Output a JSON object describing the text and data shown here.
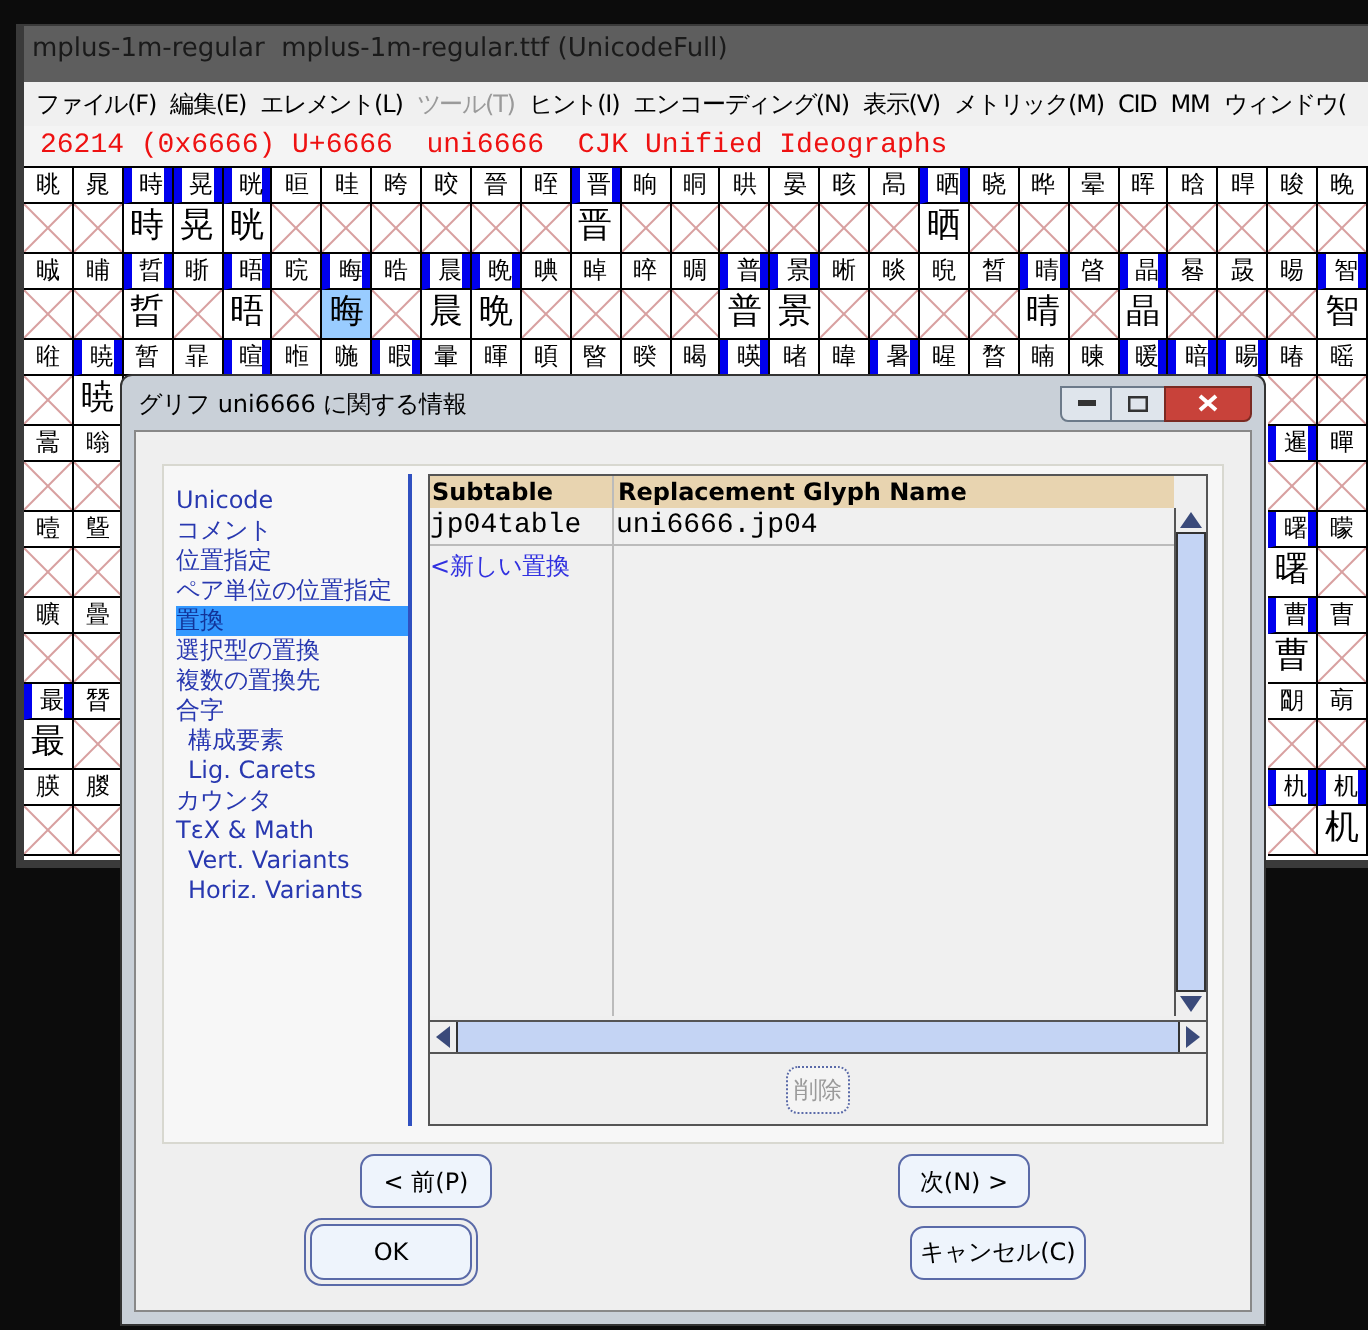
{
  "main_window": {
    "title": "mplus-1m-regular  mplus-1m-regular.ttf (UnicodeFull)",
    "menu": [
      {
        "label": "ファイル(F)",
        "disabled": false
      },
      {
        "label": "編集(E)",
        "disabled": false
      },
      {
        "label": "エレメント(L)",
        "disabled": false
      },
      {
        "label": "ツール(T)",
        "disabled": true
      },
      {
        "label": "ヒント(I)",
        "disabled": false
      },
      {
        "label": "エンコーディング(N)",
        "disabled": false
      },
      {
        "label": "表示(V)",
        "disabled": false
      },
      {
        "label": "メトリック(M)",
        "disabled": false
      },
      {
        "label": "CID",
        "disabled": false
      },
      {
        "label": "MM",
        "disabled": false
      },
      {
        "label": "ウィンドウ(",
        "disabled": false
      }
    ],
    "info_line": "26214 (0x6666) U+6666  uni6666  CJK Unified Ideographs",
    "grid": {
      "rows": [
        {
          "cells": [
            {
              "label": "晀",
              "flagged": false,
              "kind": "empty",
              "selected": false
            },
            {
              "label": "晁",
              "flagged": false,
              "kind": "empty",
              "selected": false
            },
            {
              "label": "時",
              "flagged": true,
              "kind": "glyph",
              "glyph": "時",
              "selected": false
            },
            {
              "label": "晃",
              "flagged": true,
              "kind": "glyph",
              "glyph": "晃",
              "selected": false
            },
            {
              "label": "晄",
              "flagged": true,
              "kind": "glyph",
              "glyph": "晄",
              "selected": false
            },
            {
              "label": "晅",
              "flagged": false,
              "kind": "empty",
              "selected": false
            },
            {
              "label": "晆",
              "flagged": false,
              "kind": "empty",
              "selected": false
            },
            {
              "label": "晇",
              "flagged": false,
              "kind": "empty",
              "selected": false
            },
            {
              "label": "晈",
              "flagged": false,
              "kind": "empty",
              "selected": false
            },
            {
              "label": "晉",
              "flagged": false,
              "kind": "empty",
              "selected": false
            },
            {
              "label": "晊",
              "flagged": false,
              "kind": "empty",
              "selected": false
            },
            {
              "label": "晋",
              "flagged": true,
              "kind": "glyph",
              "glyph": "晋",
              "selected": false
            },
            {
              "label": "晌",
              "flagged": false,
              "kind": "empty",
              "selected": false
            },
            {
              "label": "晍",
              "flagged": false,
              "kind": "empty",
              "selected": false
            },
            {
              "label": "晎",
              "flagged": false,
              "kind": "empty",
              "selected": false
            },
            {
              "label": "晏",
              "flagged": false,
              "kind": "empty",
              "selected": false
            },
            {
              "label": "晐",
              "flagged": false,
              "kind": "empty",
              "selected": false
            },
            {
              "label": "晑",
              "flagged": false,
              "kind": "empty",
              "selected": false
            },
            {
              "label": "晒",
              "flagged": true,
              "kind": "glyph",
              "glyph": "晒",
              "selected": false
            },
            {
              "label": "晓",
              "flagged": false,
              "kind": "empty",
              "selected": false
            },
            {
              "label": "晔",
              "flagged": false,
              "kind": "empty",
              "selected": false
            },
            {
              "label": "晕",
              "flagged": false,
              "kind": "empty",
              "selected": false
            },
            {
              "label": "晖",
              "flagged": false,
              "kind": "empty",
              "selected": false
            },
            {
              "label": "晗",
              "flagged": false,
              "kind": "empty",
              "selected": false
            },
            {
              "label": "晘",
              "flagged": false,
              "kind": "empty",
              "selected": false
            },
            {
              "label": "晙",
              "flagged": false,
              "kind": "empty",
              "selected": false
            },
            {
              "label": "晚",
              "flagged": false,
              "kind": "empty",
              "selected": false
            }
          ]
        },
        {
          "cells": [
            {
              "label": "晠",
              "flagged": false,
              "kind": "empty",
              "selected": false
            },
            {
              "label": "晡",
              "flagged": false,
              "kind": "empty",
              "selected": false
            },
            {
              "label": "晢",
              "flagged": true,
              "kind": "glyph",
              "glyph": "晢",
              "selected": false
            },
            {
              "label": "晣",
              "flagged": false,
              "kind": "empty",
              "selected": false
            },
            {
              "label": "晤",
              "flagged": true,
              "kind": "glyph",
              "glyph": "晤",
              "selected": false
            },
            {
              "label": "晥",
              "flagged": false,
              "kind": "empty",
              "selected": false
            },
            {
              "label": "晦",
              "flagged": true,
              "kind": "glyph",
              "glyph": "晦",
              "selected": true
            },
            {
              "label": "晧",
              "flagged": false,
              "kind": "empty",
              "selected": false
            },
            {
              "label": "晨",
              "flagged": true,
              "kind": "glyph",
              "glyph": "晨",
              "selected": false
            },
            {
              "label": "晩",
              "flagged": true,
              "kind": "glyph",
              "glyph": "晩",
              "selected": false
            },
            {
              "label": "晪",
              "flagged": false,
              "kind": "empty",
              "selected": false
            },
            {
              "label": "晫",
              "flagged": false,
              "kind": "empty",
              "selected": false
            },
            {
              "label": "晬",
              "flagged": false,
              "kind": "empty",
              "selected": false
            },
            {
              "label": "晭",
              "flagged": false,
              "kind": "empty",
              "selected": false
            },
            {
              "label": "普",
              "flagged": true,
              "kind": "glyph",
              "glyph": "普",
              "selected": false
            },
            {
              "label": "景",
              "flagged": true,
              "kind": "glyph",
              "glyph": "景",
              "selected": false
            },
            {
              "label": "晰",
              "flagged": false,
              "kind": "empty",
              "selected": false
            },
            {
              "label": "晱",
              "flagged": false,
              "kind": "empty",
              "selected": false
            },
            {
              "label": "晲",
              "flagged": false,
              "kind": "empty",
              "selected": false
            },
            {
              "label": "晳",
              "flagged": false,
              "kind": "empty",
              "selected": false
            },
            {
              "label": "晴",
              "flagged": true,
              "kind": "glyph",
              "glyph": "晴",
              "selected": false
            },
            {
              "label": "晵",
              "flagged": false,
              "kind": "empty",
              "selected": false
            },
            {
              "label": "晶",
              "flagged": true,
              "kind": "glyph",
              "glyph": "晶",
              "selected": false
            },
            {
              "label": "晷",
              "flagged": false,
              "kind": "empty",
              "selected": false
            },
            {
              "label": "晸",
              "flagged": false,
              "kind": "empty",
              "selected": false
            },
            {
              "label": "晹",
              "flagged": false,
              "kind": "empty",
              "selected": false
            },
            {
              "label": "智",
              "flagged": true,
              "kind": "glyph",
              "glyph": "智",
              "selected": false
            }
          ]
        },
        {
          "cells": [
            {
              "label": "暀",
              "flagged": false,
              "kind": "empty",
              "selected": false
            },
            {
              "label": "暁",
              "flagged": true,
              "kind": "glyph",
              "glyph": "暁",
              "selected": false
            },
            {
              "label": "暂",
              "flagged": false,
              "kind": "hidden",
              "selected": false
            },
            {
              "label": "暃",
              "flagged": false,
              "kind": "hidden",
              "selected": false
            },
            {
              "label": "暄",
              "flagged": true,
              "kind": "hidden",
              "selected": false
            },
            {
              "label": "暅",
              "flagged": false,
              "kind": "hidden",
              "selected": false
            },
            {
              "label": "暆",
              "flagged": false,
              "kind": "hidden",
              "selected": false
            },
            {
              "label": "暇",
              "flagged": true,
              "kind": "hidden",
              "selected": false
            },
            {
              "label": "暈",
              "flagged": false,
              "kind": "hidden",
              "selected": false
            },
            {
              "label": "暉",
              "flagged": false,
              "kind": "hidden",
              "selected": false
            },
            {
              "label": "暊",
              "flagged": false,
              "kind": "hidden",
              "selected": false
            },
            {
              "label": "暋",
              "flagged": false,
              "kind": "hidden",
              "selected": false
            },
            {
              "label": "暌",
              "flagged": false,
              "kind": "hidden",
              "selected": false
            },
            {
              "label": "暍",
              "flagged": false,
              "kind": "hidden",
              "selected": false
            },
            {
              "label": "暎",
              "flagged": true,
              "kind": "hidden",
              "selected": false
            },
            {
              "label": "暏",
              "flagged": false,
              "kind": "hidden",
              "selected": false
            },
            {
              "label": "暐",
              "flagged": false,
              "kind": "hidden",
              "selected": false
            },
            {
              "label": "暑",
              "flagged": true,
              "kind": "hidden",
              "selected": false
            },
            {
              "label": "暒",
              "flagged": false,
              "kind": "hidden",
              "selected": false
            },
            {
              "label": "暓",
              "flagged": false,
              "kind": "hidden",
              "selected": false
            },
            {
              "label": "暔",
              "flagged": false,
              "kind": "hidden",
              "selected": false
            },
            {
              "label": "暕",
              "flagged": false,
              "kind": "hidden",
              "selected": false
            },
            {
              "label": "暖",
              "flagged": true,
              "kind": "hidden",
              "selected": false
            },
            {
              "label": "暗",
              "flagged": true,
              "kind": "hidden",
              "selected": false
            },
            {
              "label": "暘",
              "flagged": true,
              "kind": "hidden",
              "selected": false
            },
            {
              "label": "暙",
              "flagged": false,
              "kind": "empty",
              "selected": false
            },
            {
              "label": "暚",
              "flagged": false,
              "kind": "empty",
              "selected": false
            }
          ]
        },
        {
          "left": [
            {
              "label": "暠",
              "flagged": false,
              "kind": "empty",
              "selected": false
            },
            {
              "label": "暡",
              "flagged": false,
              "kind": "empty",
              "selected": false
            }
          ],
          "right": [
            {
              "label": "暹",
              "flagged": true,
              "kind": "empty",
              "selected": false
            },
            {
              "label": "暺",
              "flagged": false,
              "kind": "empty",
              "selected": false
            }
          ]
        },
        {
          "left": [
            {
              "label": "曀",
              "flagged": false,
              "kind": "empty",
              "selected": false
            },
            {
              "label": "曁",
              "flagged": false,
              "kind": "empty",
              "selected": false
            }
          ],
          "right": [
            {
              "label": "曙",
              "flagged": true,
              "kind": "glyph",
              "glyph": "曙",
              "selected": false
            },
            {
              "label": "曚",
              "flagged": false,
              "kind": "empty",
              "selected": false
            }
          ]
        },
        {
          "left": [
            {
              "label": "曠",
              "flagged": false,
              "kind": "empty",
              "selected": false
            },
            {
              "label": "曡",
              "flagged": false,
              "kind": "empty",
              "selected": false
            }
          ],
          "right": [
            {
              "label": "曹",
              "flagged": true,
              "kind": "glyph",
              "glyph": "曹",
              "selected": false
            },
            {
              "label": "曺",
              "flagged": false,
              "kind": "empty",
              "selected": false
            }
          ]
        },
        {
          "left": [
            {
              "label": "最",
              "flagged": true,
              "kind": "glyph",
              "glyph": "最",
              "selected": false
            },
            {
              "label": "朁",
              "flagged": false,
              "kind": "empty",
              "selected": false
            }
          ],
          "right": [
            {
              "label": "朙",
              "flagged": false,
              "kind": "empty",
              "selected": false
            },
            {
              "label": "朚",
              "flagged": false,
              "kind": "empty",
              "selected": false
            }
          ]
        },
        {
          "left": [
            {
              "label": "朠",
              "flagged": false,
              "kind": "empty",
              "selected": false
            },
            {
              "label": "朡",
              "flagged": false,
              "kind": "empty",
              "selected": false
            }
          ],
          "right": [
            {
              "label": "朹",
              "flagged": true,
              "kind": "empty",
              "selected": false
            },
            {
              "label": "机",
              "flagged": true,
              "kind": "glyph",
              "glyph": "机",
              "selected": false
            }
          ]
        }
      ]
    }
  },
  "dialog": {
    "title": "グリフ uni6666 に関する情報",
    "sections": [
      {
        "label": "Unicode",
        "selected": false
      },
      {
        "label": "コメント",
        "selected": false
      },
      {
        "label": "位置指定",
        "selected": false
      },
      {
        "label": "ペア単位の位置指定",
        "selected": false
      },
      {
        "label": "置換",
        "selected": true
      },
      {
        "label": "選択型の置換",
        "selected": false
      },
      {
        "label": "複数の置換先",
        "selected": false
      },
      {
        "label": "合字",
        "selected": false,
        "children": [
          {
            "label": "構成要素",
            "selected": false
          },
          {
            "label": "Lig. Carets",
            "selected": false
          }
        ]
      },
      {
        "label": "カウンタ",
        "selected": false
      },
      {
        "label": "TεX & Math",
        "selected": false,
        "children": [
          {
            "label": "Vert. Variants",
            "selected": false
          },
          {
            "label": "Horiz. Variants",
            "selected": false
          }
        ]
      }
    ],
    "table": {
      "columns": [
        "Subtable",
        "Replacement Glyph Name"
      ],
      "rows": [
        [
          "jp04table",
          "uni6666.jp04"
        ]
      ],
      "new_entry": "<新しい置換"
    },
    "delete_button": {
      "label": "削除",
      "disabled": true
    },
    "prev_button": "< 前(P)",
    "next_button": "次(N) >",
    "ok_button": "OK",
    "cancel_button": "キャンセル(C)"
  }
}
